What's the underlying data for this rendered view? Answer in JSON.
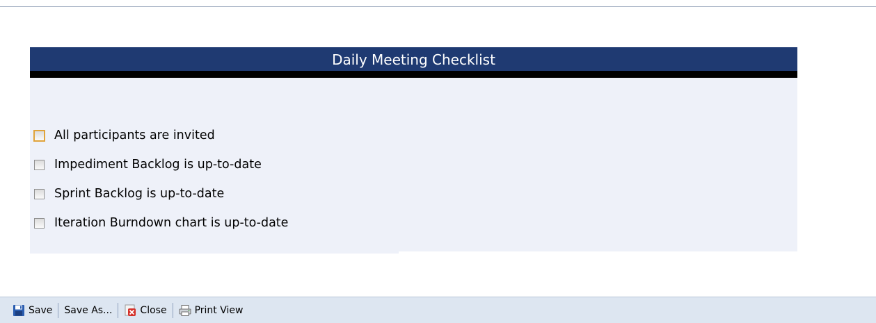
{
  "panel": {
    "title": "Daily Meeting Checklist",
    "items": [
      {
        "label": "All participants are invited",
        "checked": false,
        "focused": true
      },
      {
        "label": "Impediment Backlog is up-to-date",
        "checked": false,
        "focused": false
      },
      {
        "label": "Sprint Backlog is up-to-date",
        "checked": false,
        "focused": false
      },
      {
        "label": "Iteration Burndown chart is up-to-date",
        "checked": false,
        "focused": false
      }
    ]
  },
  "toolbar": {
    "save": {
      "label": "Save",
      "icon": "save-icon"
    },
    "save_as": {
      "label": "Save As..."
    },
    "close": {
      "label": "Close",
      "icon": "close-icon"
    },
    "print_view": {
      "label": "Print View",
      "icon": "printer-icon"
    }
  },
  "colors": {
    "header_bg": "#1f3a72",
    "body_bg": "#eef1f9",
    "focus_border": "#e0a33a",
    "toolbar_bg": "#dde6f1"
  }
}
